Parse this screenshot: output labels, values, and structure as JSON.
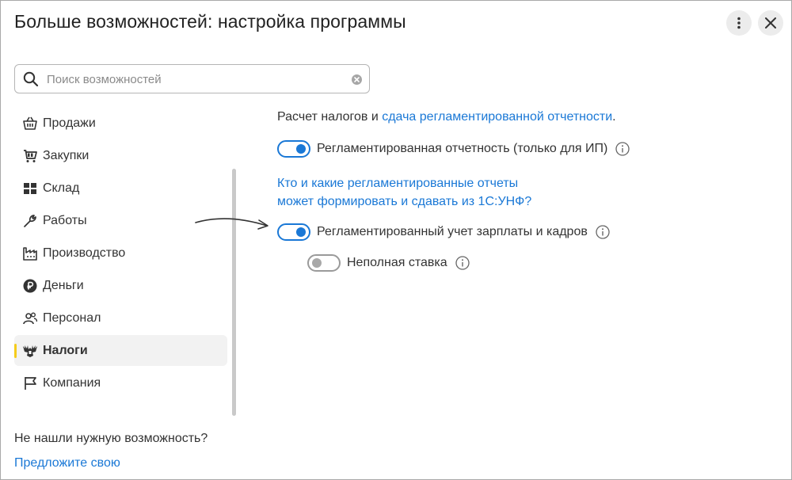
{
  "header": {
    "title": "Больше возможностей: настройка программы",
    "more_icon": "kebab-vertical-icon",
    "close_icon": "close-x-icon"
  },
  "search": {
    "placeholder": "Поиск возможностей",
    "value": ""
  },
  "sidebar": {
    "items": [
      {
        "label": "Продажи",
        "icon": "basket-icon",
        "active": false
      },
      {
        "label": "Закупки",
        "icon": "cart-icon",
        "active": false
      },
      {
        "label": "Склад",
        "icon": "warehouse-grid-icon",
        "active": false
      },
      {
        "label": "Работы",
        "icon": "wrench-icon",
        "active": false
      },
      {
        "label": "Производство",
        "icon": "factory-icon",
        "active": false
      },
      {
        "label": "Деньги",
        "icon": "ruble-coin-icon",
        "active": false
      },
      {
        "label": "Персонал",
        "icon": "people-icon",
        "active": false
      },
      {
        "label": "Налоги",
        "icon": "eagle-emblem-icon",
        "active": true
      },
      {
        "label": "Компания",
        "icon": "flag-icon",
        "active": false
      }
    ],
    "accent_color": "#f5cc1c"
  },
  "footer": {
    "question": "Не нашли нужную возможность?",
    "link": "Предложите свою"
  },
  "content": {
    "intro_text": "Расчет налогов и ",
    "intro_link": "сдача регламентированной отчетности",
    "intro_end": ".",
    "options": [
      {
        "label": "Регламентированная отчетность (только для ИП)",
        "enabled": true
      },
      {
        "label": "Регламентированный учет зарплаты и кадров",
        "enabled": true
      },
      {
        "label": "Неполная ставка",
        "enabled": false
      }
    ],
    "help_link_line1": "Кто и какие регламентированные отчеты",
    "help_link_line2": "может формировать и сдавать из 1С:УНФ?"
  },
  "colors": {
    "link": "#1a78d6",
    "toggle_on": "#1a78d6",
    "toggle_off": "#9a9a9a"
  }
}
